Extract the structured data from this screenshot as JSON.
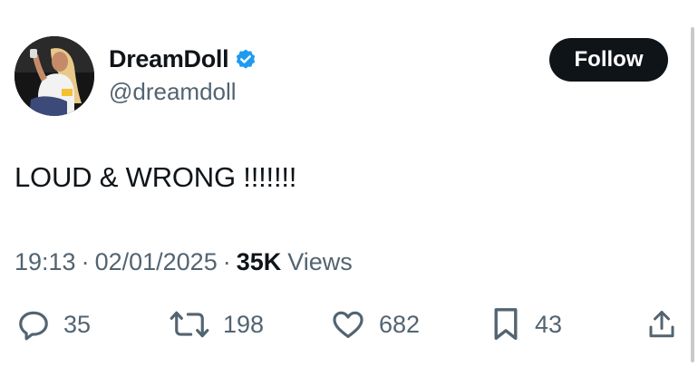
{
  "author": {
    "display_name": "DreamDoll",
    "handle": "@dreamdoll",
    "verified": true,
    "avatar_icon": "profile-photo"
  },
  "follow_label": "Follow",
  "tweet": {
    "text": "LOUD & WRONG !!!!!!!",
    "time": "19:13",
    "separator": "·",
    "date": "02/01/2025",
    "views_count": "35K",
    "views_label": "Views"
  },
  "actions": {
    "replies": "35",
    "retweets": "198",
    "likes": "682",
    "bookmarks": "43"
  },
  "colors": {
    "text_primary": "#0f1419",
    "text_secondary": "#536471",
    "verified_blue": "#1d9bf0",
    "follow_bg": "#0f1419"
  }
}
